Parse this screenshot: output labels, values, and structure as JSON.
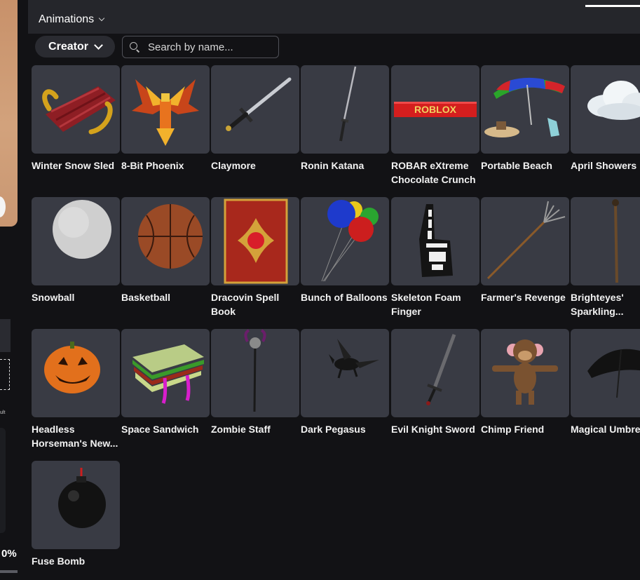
{
  "header": {
    "animations_label": "Animations"
  },
  "filters": {
    "creator_label": "Creator",
    "search_placeholder": "Search by name..."
  },
  "left_strip": {
    "percent": "0%",
    "tiny_label": "ult"
  },
  "items": [
    {
      "name": "Winter Snow Sled",
      "icon": "sled-icon"
    },
    {
      "name": "8-Bit Phoenix",
      "icon": "phoenix-icon"
    },
    {
      "name": "Claymore",
      "icon": "sword-icon"
    },
    {
      "name": "Ronin Katana",
      "icon": "katana-icon"
    },
    {
      "name": "ROBAR eXtreme Chocolate Crunch",
      "icon": "chocolate-bar-icon",
      "bar_text": "ROBLOX"
    },
    {
      "name": "Portable Beach",
      "icon": "beach-umbrella-icon"
    },
    {
      "name": "April Showers",
      "icon": "cloud-icon"
    },
    {
      "name": "Snowball",
      "icon": "snowball-icon"
    },
    {
      "name": "Basketball",
      "icon": "basketball-icon"
    },
    {
      "name": "Dracovin Spell Book",
      "icon": "spellbook-icon"
    },
    {
      "name": "Bunch of Balloons",
      "icon": "balloons-icon"
    },
    {
      "name": "Skeleton Foam Finger",
      "icon": "foam-finger-icon"
    },
    {
      "name": "Farmer's Revenge",
      "icon": "pitchfork-icon"
    },
    {
      "name": "Brighteyes' Sparkling...",
      "icon": "wand-icon"
    },
    {
      "name": "Headless Horseman's New...",
      "icon": "pumpkin-icon"
    },
    {
      "name": "Space Sandwich",
      "icon": "sandwich-icon"
    },
    {
      "name": "Zombie Staff",
      "icon": "staff-icon"
    },
    {
      "name": "Dark Pegasus",
      "icon": "pegasus-icon"
    },
    {
      "name": "Evil Knight Sword",
      "icon": "dark-sword-icon"
    },
    {
      "name": "Chimp Friend",
      "icon": "monkey-icon"
    },
    {
      "name": "Magical Umbre",
      "icon": "umbrella-icon"
    },
    {
      "name": "Fuse Bomb",
      "icon": "bomb-icon"
    }
  ]
}
